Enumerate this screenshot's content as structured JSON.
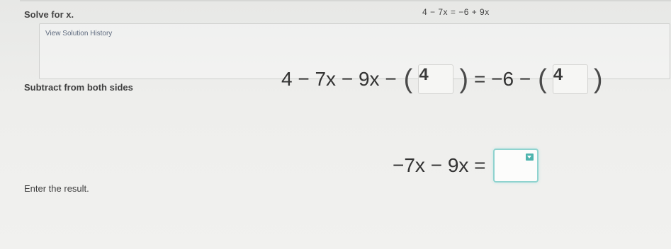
{
  "problem": {
    "title": "Solve for x.",
    "equation": "4 − 7x = −6 + 9x"
  },
  "history": {
    "link_label": "View Solution History"
  },
  "step": {
    "label": "Subtract from both sides",
    "lhs": "4 − 7x − 9x −",
    "left_open": "(",
    "left_box": "4",
    "left_close": ")",
    "equals_rhs": "= −6 −",
    "right_open": "(",
    "right_box": "4",
    "right_close": ")"
  },
  "result": {
    "label": "Enter the result.",
    "lhs": "−7x − 9x =",
    "answer_value": "",
    "dropdown_icon": "caret-down-icon"
  }
}
